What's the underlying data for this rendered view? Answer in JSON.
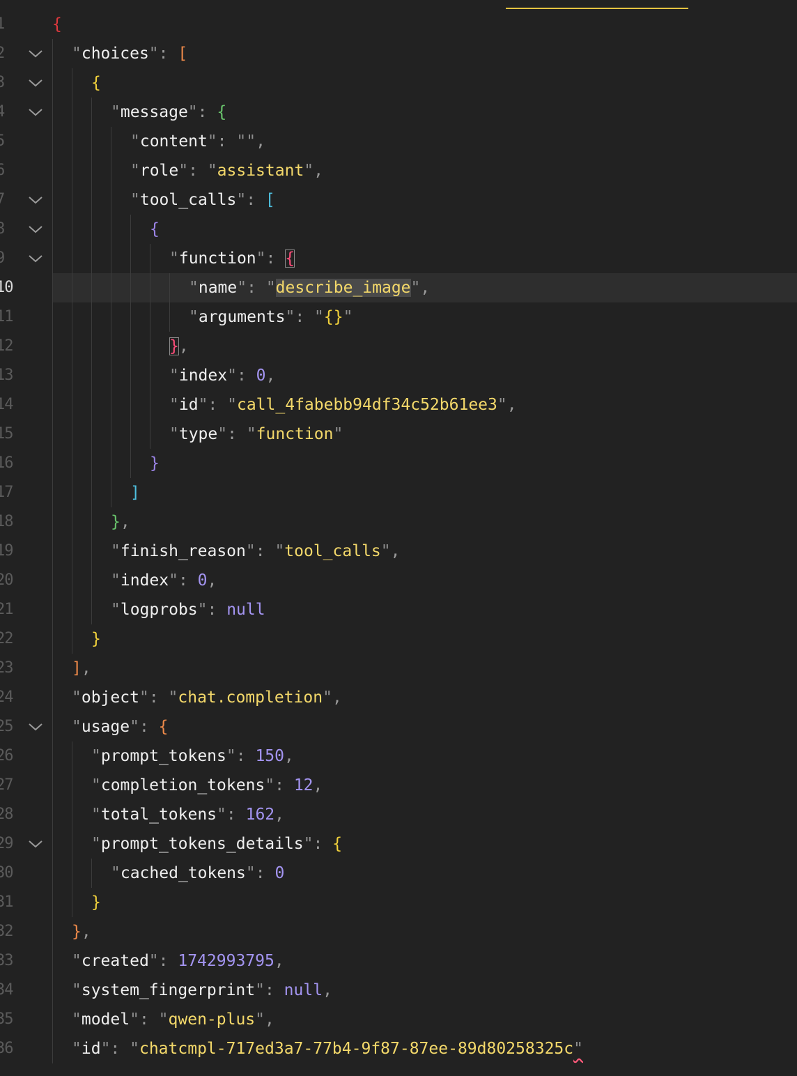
{
  "editor": {
    "current_line": 10,
    "lines": [
      {
        "n": "1",
        "indent": 0,
        "fold": false,
        "t": [
          {
            "c": "b-red",
            "v": "{"
          }
        ]
      },
      {
        "n": "2",
        "indent": 1,
        "fold": true,
        "t": [
          {
            "c": "q",
            "v": "\""
          },
          {
            "c": "k",
            "v": "choices"
          },
          {
            "c": "q",
            "v": "\""
          },
          {
            "c": "p",
            "v": ": "
          },
          {
            "c": "b-org",
            "v": "["
          }
        ]
      },
      {
        "n": "3",
        "indent": 2,
        "fold": true,
        "t": [
          {
            "c": "b-yel",
            "v": "{"
          }
        ]
      },
      {
        "n": "4",
        "indent": 3,
        "fold": true,
        "t": [
          {
            "c": "q",
            "v": "\""
          },
          {
            "c": "k",
            "v": "message"
          },
          {
            "c": "q",
            "v": "\""
          },
          {
            "c": "p",
            "v": ": "
          },
          {
            "c": "b-grn",
            "v": "{"
          }
        ]
      },
      {
        "n": "5",
        "indent": 4,
        "fold": false,
        "t": [
          {
            "c": "q",
            "v": "\""
          },
          {
            "c": "k",
            "v": "content"
          },
          {
            "c": "q",
            "v": "\""
          },
          {
            "c": "p",
            "v": ": "
          },
          {
            "c": "q",
            "v": "\"\""
          },
          {
            "c": "p",
            "v": ","
          }
        ]
      },
      {
        "n": "6",
        "indent": 4,
        "fold": false,
        "t": [
          {
            "c": "q",
            "v": "\""
          },
          {
            "c": "k",
            "v": "role"
          },
          {
            "c": "q",
            "v": "\""
          },
          {
            "c": "p",
            "v": ": "
          },
          {
            "c": "q",
            "v": "\""
          },
          {
            "c": "s",
            "v": "assistant"
          },
          {
            "c": "q",
            "v": "\""
          },
          {
            "c": "p",
            "v": ","
          }
        ]
      },
      {
        "n": "7",
        "indent": 4,
        "fold": true,
        "t": [
          {
            "c": "q",
            "v": "\""
          },
          {
            "c": "k",
            "v": "tool_calls"
          },
          {
            "c": "q",
            "v": "\""
          },
          {
            "c": "p",
            "v": ": "
          },
          {
            "c": "b-cyn",
            "v": "["
          }
        ]
      },
      {
        "n": "8",
        "indent": 5,
        "fold": true,
        "t": [
          {
            "c": "b-pur",
            "v": "{"
          }
        ]
      },
      {
        "n": "9",
        "indent": 6,
        "fold": true,
        "t": [
          {
            "c": "q",
            "v": "\""
          },
          {
            "c": "k",
            "v": "function"
          },
          {
            "c": "q",
            "v": "\""
          },
          {
            "c": "p",
            "v": ": "
          },
          {
            "c": "b-pink bmatch",
            "v": "{"
          }
        ]
      },
      {
        "n": "10",
        "indent": 7,
        "fold": false,
        "t": [
          {
            "c": "q",
            "v": "\""
          },
          {
            "c": "k",
            "v": "name"
          },
          {
            "c": "q",
            "v": "\""
          },
          {
            "c": "p",
            "v": ": "
          },
          {
            "c": "q",
            "v": "\""
          },
          {
            "c": "s sel",
            "v": "describe_image"
          },
          {
            "c": "q",
            "v": "\""
          },
          {
            "c": "p",
            "v": ","
          }
        ]
      },
      {
        "n": "11",
        "indent": 7,
        "fold": false,
        "t": [
          {
            "c": "q",
            "v": "\""
          },
          {
            "c": "k",
            "v": "arguments"
          },
          {
            "c": "q",
            "v": "\""
          },
          {
            "c": "p",
            "v": ": "
          },
          {
            "c": "q",
            "v": "\""
          },
          {
            "c": "b-yel",
            "v": "{}"
          },
          {
            "c": "q",
            "v": "\""
          }
        ]
      },
      {
        "n": "12",
        "indent": 6,
        "fold": false,
        "t": [
          {
            "c": "b-pink bmatch",
            "v": "}"
          },
          {
            "c": "p",
            "v": ","
          }
        ]
      },
      {
        "n": "13",
        "indent": 6,
        "fold": false,
        "t": [
          {
            "c": "q",
            "v": "\""
          },
          {
            "c": "k",
            "v": "index"
          },
          {
            "c": "q",
            "v": "\""
          },
          {
            "c": "p",
            "v": ": "
          },
          {
            "c": "n",
            "v": "0"
          },
          {
            "c": "p",
            "v": ","
          }
        ]
      },
      {
        "n": "14",
        "indent": 6,
        "fold": false,
        "t": [
          {
            "c": "q",
            "v": "\""
          },
          {
            "c": "k",
            "v": "id"
          },
          {
            "c": "q",
            "v": "\""
          },
          {
            "c": "p",
            "v": ": "
          },
          {
            "c": "q",
            "v": "\""
          },
          {
            "c": "s",
            "v": "call_4fabebb94df34c52b61ee3"
          },
          {
            "c": "q",
            "v": "\""
          },
          {
            "c": "p",
            "v": ","
          }
        ]
      },
      {
        "n": "15",
        "indent": 6,
        "fold": false,
        "t": [
          {
            "c": "q",
            "v": "\""
          },
          {
            "c": "k",
            "v": "type"
          },
          {
            "c": "q",
            "v": "\""
          },
          {
            "c": "p",
            "v": ": "
          },
          {
            "c": "q",
            "v": "\""
          },
          {
            "c": "s",
            "v": "function"
          },
          {
            "c": "q",
            "v": "\""
          }
        ]
      },
      {
        "n": "16",
        "indent": 5,
        "fold": false,
        "t": [
          {
            "c": "b-pur",
            "v": "}"
          }
        ]
      },
      {
        "n": "17",
        "indent": 4,
        "fold": false,
        "t": [
          {
            "c": "b-cyn",
            "v": "]"
          }
        ]
      },
      {
        "n": "18",
        "indent": 3,
        "fold": false,
        "t": [
          {
            "c": "b-grn",
            "v": "}"
          },
          {
            "c": "p",
            "v": ","
          }
        ]
      },
      {
        "n": "19",
        "indent": 3,
        "fold": false,
        "t": [
          {
            "c": "q",
            "v": "\""
          },
          {
            "c": "k",
            "v": "finish_reason"
          },
          {
            "c": "q",
            "v": "\""
          },
          {
            "c": "p",
            "v": ": "
          },
          {
            "c": "q",
            "v": "\""
          },
          {
            "c": "s",
            "v": "tool_calls"
          },
          {
            "c": "q",
            "v": "\""
          },
          {
            "c": "p",
            "v": ","
          }
        ]
      },
      {
        "n": "20",
        "indent": 3,
        "fold": false,
        "t": [
          {
            "c": "q",
            "v": "\""
          },
          {
            "c": "k",
            "v": "index"
          },
          {
            "c": "q",
            "v": "\""
          },
          {
            "c": "p",
            "v": ": "
          },
          {
            "c": "n",
            "v": "0"
          },
          {
            "c": "p",
            "v": ","
          }
        ]
      },
      {
        "n": "21",
        "indent": 3,
        "fold": false,
        "t": [
          {
            "c": "q",
            "v": "\""
          },
          {
            "c": "k",
            "v": "logprobs"
          },
          {
            "c": "q",
            "v": "\""
          },
          {
            "c": "p",
            "v": ": "
          },
          {
            "c": "n",
            "v": "null"
          }
        ]
      },
      {
        "n": "22",
        "indent": 2,
        "fold": false,
        "t": [
          {
            "c": "b-yel",
            "v": "}"
          }
        ]
      },
      {
        "n": "23",
        "indent": 1,
        "fold": false,
        "t": [
          {
            "c": "b-org",
            "v": "]"
          },
          {
            "c": "p",
            "v": ","
          }
        ]
      },
      {
        "n": "24",
        "indent": 1,
        "fold": false,
        "t": [
          {
            "c": "q",
            "v": "\""
          },
          {
            "c": "k",
            "v": "object"
          },
          {
            "c": "q",
            "v": "\""
          },
          {
            "c": "p",
            "v": ": "
          },
          {
            "c": "q",
            "v": "\""
          },
          {
            "c": "s",
            "v": "chat.completion"
          },
          {
            "c": "q",
            "v": "\""
          },
          {
            "c": "p",
            "v": ","
          }
        ]
      },
      {
        "n": "25",
        "indent": 1,
        "fold": true,
        "t": [
          {
            "c": "q",
            "v": "\""
          },
          {
            "c": "k",
            "v": "usage"
          },
          {
            "c": "q",
            "v": "\""
          },
          {
            "c": "p",
            "v": ": "
          },
          {
            "c": "b-org",
            "v": "{"
          }
        ]
      },
      {
        "n": "26",
        "indent": 2,
        "fold": false,
        "t": [
          {
            "c": "q",
            "v": "\""
          },
          {
            "c": "k",
            "v": "prompt_tokens"
          },
          {
            "c": "q",
            "v": "\""
          },
          {
            "c": "p",
            "v": ": "
          },
          {
            "c": "n",
            "v": "150"
          },
          {
            "c": "p",
            "v": ","
          }
        ]
      },
      {
        "n": "27",
        "indent": 2,
        "fold": false,
        "t": [
          {
            "c": "q",
            "v": "\""
          },
          {
            "c": "k",
            "v": "completion_tokens"
          },
          {
            "c": "q",
            "v": "\""
          },
          {
            "c": "p",
            "v": ": "
          },
          {
            "c": "n",
            "v": "12"
          },
          {
            "c": "p",
            "v": ","
          }
        ]
      },
      {
        "n": "28",
        "indent": 2,
        "fold": false,
        "t": [
          {
            "c": "q",
            "v": "\""
          },
          {
            "c": "k",
            "v": "total_tokens"
          },
          {
            "c": "q",
            "v": "\""
          },
          {
            "c": "p",
            "v": ": "
          },
          {
            "c": "n",
            "v": "162"
          },
          {
            "c": "p",
            "v": ","
          }
        ]
      },
      {
        "n": "29",
        "indent": 2,
        "fold": true,
        "t": [
          {
            "c": "q",
            "v": "\""
          },
          {
            "c": "k",
            "v": "prompt_tokens_details"
          },
          {
            "c": "q",
            "v": "\""
          },
          {
            "c": "p",
            "v": ": "
          },
          {
            "c": "b-yel",
            "v": "{"
          }
        ]
      },
      {
        "n": "30",
        "indent": 3,
        "fold": false,
        "t": [
          {
            "c": "q",
            "v": "\""
          },
          {
            "c": "k",
            "v": "cached_tokens"
          },
          {
            "c": "q",
            "v": "\""
          },
          {
            "c": "p",
            "v": ": "
          },
          {
            "c": "n",
            "v": "0"
          }
        ]
      },
      {
        "n": "31",
        "indent": 2,
        "fold": false,
        "t": [
          {
            "c": "b-yel",
            "v": "}"
          }
        ]
      },
      {
        "n": "32",
        "indent": 1,
        "fold": false,
        "t": [
          {
            "c": "b-org",
            "v": "}"
          },
          {
            "c": "p",
            "v": ","
          }
        ]
      },
      {
        "n": "33",
        "indent": 1,
        "fold": false,
        "t": [
          {
            "c": "q",
            "v": "\""
          },
          {
            "c": "k",
            "v": "created"
          },
          {
            "c": "q",
            "v": "\""
          },
          {
            "c": "p",
            "v": ": "
          },
          {
            "c": "n",
            "v": "1742993795"
          },
          {
            "c": "p",
            "v": ","
          }
        ]
      },
      {
        "n": "34",
        "indent": 1,
        "fold": false,
        "t": [
          {
            "c": "q",
            "v": "\""
          },
          {
            "c": "k",
            "v": "system_fingerprint"
          },
          {
            "c": "q",
            "v": "\""
          },
          {
            "c": "p",
            "v": ": "
          },
          {
            "c": "n",
            "v": "null"
          },
          {
            "c": "p",
            "v": ","
          }
        ]
      },
      {
        "n": "35",
        "indent": 1,
        "fold": false,
        "t": [
          {
            "c": "q",
            "v": "\""
          },
          {
            "c": "k",
            "v": "model"
          },
          {
            "c": "q",
            "v": "\""
          },
          {
            "c": "p",
            "v": ": "
          },
          {
            "c": "q",
            "v": "\""
          },
          {
            "c": "s",
            "v": "qwen-plus"
          },
          {
            "c": "q",
            "v": "\""
          },
          {
            "c": "p",
            "v": ","
          }
        ]
      },
      {
        "n": "36",
        "indent": 1,
        "fold": false,
        "t": [
          {
            "c": "q",
            "v": "\""
          },
          {
            "c": "k",
            "v": "id"
          },
          {
            "c": "q",
            "v": "\""
          },
          {
            "c": "p",
            "v": ": "
          },
          {
            "c": "q",
            "v": "\""
          },
          {
            "c": "s",
            "v": "chatcmpl-717ed3a7-77b4-9f87-87ee-89d80258325c"
          },
          {
            "c": "q squiggle",
            "v": "\""
          }
        ]
      }
    ]
  }
}
